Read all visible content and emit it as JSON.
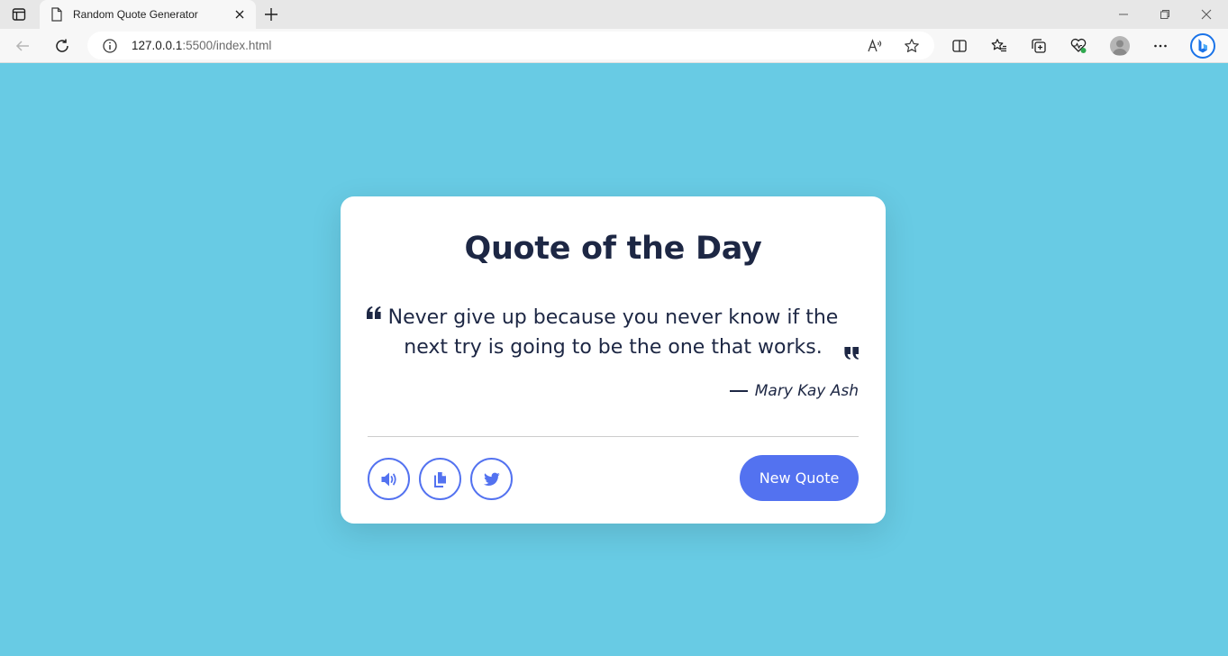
{
  "browser": {
    "tab": {
      "title": "Random Quote Generator"
    },
    "address": {
      "url_main": "127.0.0.1",
      "url_rest": ":5500/index.html"
    }
  },
  "page": {
    "title": "Quote of the Day",
    "quote_text": "Never give up because you never know if the next try is going to be the one that works.",
    "author": "Mary Kay Ash",
    "new_quote_label": "New Quote",
    "colors": {
      "background": "#68cbe4",
      "accent": "#5372f0",
      "text": "#1d2744"
    },
    "icons": [
      "speaker-icon",
      "copy-icon",
      "twitter-icon"
    ]
  }
}
